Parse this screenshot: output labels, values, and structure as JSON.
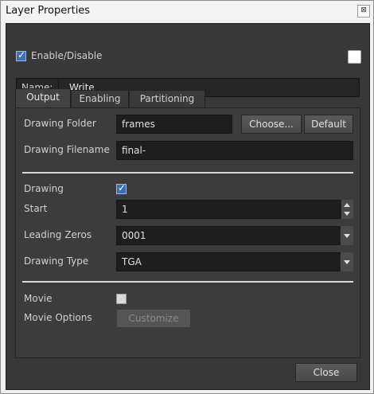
{
  "window": {
    "title": "Layer Properties",
    "close_glyph": "⊠"
  },
  "header": {
    "enable_label": "Enable/Disable",
    "enable_checked": true,
    "color_swatch": "#ffffff"
  },
  "name": {
    "label": "Name:",
    "value": "Write"
  },
  "tabs": [
    {
      "label": "Output",
      "active": true
    },
    {
      "label": "Enabling",
      "active": false
    },
    {
      "label": "Partitioning",
      "active": false
    }
  ],
  "output": {
    "drawing_folder": {
      "label": "Drawing Folder",
      "value": "frames",
      "choose_label": "Choose...",
      "default_label": "Default"
    },
    "drawing_filename": {
      "label": "Drawing Filename",
      "value": "final-"
    },
    "drawing": {
      "label": "Drawing",
      "checked": true
    },
    "start": {
      "label": "Start",
      "value": "1"
    },
    "leading_zeros": {
      "label": "Leading Zeros",
      "value": "0001"
    },
    "drawing_type": {
      "label": "Drawing Type",
      "value": "TGA"
    },
    "movie": {
      "label": "Movie",
      "checked": false
    },
    "movie_options": {
      "label": "Movie Options",
      "customize_label": "Customize"
    }
  },
  "footer": {
    "close_label": "Close"
  },
  "colors": {
    "panel_bg": "#383838",
    "field_bg": "#1e1e1e",
    "accent_check": "#3d6fb8"
  }
}
